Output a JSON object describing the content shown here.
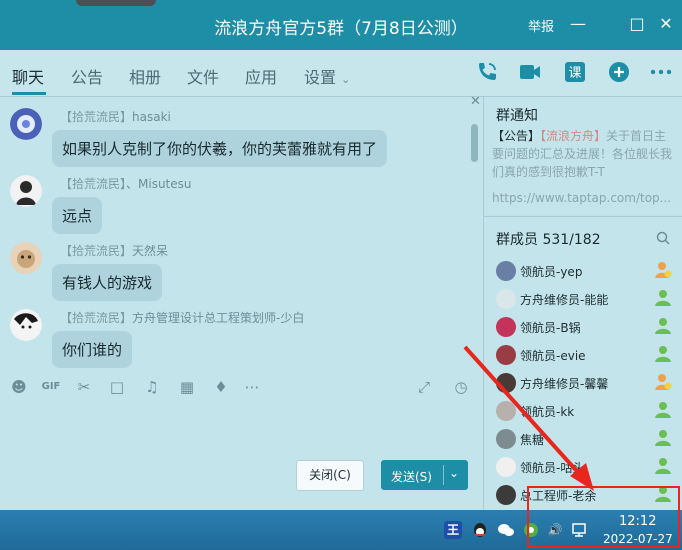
{
  "window": {
    "title": "流浪方舟官方5群（7月8日公测）",
    "report_label": "举报"
  },
  "tabs": [
    {
      "label": "聊天"
    },
    {
      "label": "公告"
    },
    {
      "label": "相册"
    },
    {
      "label": "文件"
    },
    {
      "label": "应用"
    },
    {
      "label": "设置"
    }
  ],
  "toolbar_icons": [
    "phone-icon",
    "video-icon",
    "class-icon",
    "add-icon",
    "more-icon"
  ],
  "messages": [
    {
      "badge": "【拾荒流民】",
      "sender": "hasaki",
      "text": "如果别人克制了你的伏羲，你的芙蕾雅就有用了"
    },
    {
      "badge": "【拾荒流民】",
      "sender": "、Misutesu",
      "text": "远点"
    },
    {
      "badge": "【拾荒流民】",
      "sender": "天然呆",
      "text": "有钱人的游戏"
    },
    {
      "badge": "【拾荒流民】",
      "sender": "方舟管理设计总工程策划师-少白",
      "text": "你们谁的"
    }
  ],
  "input": {
    "close_label": "关闭(C)",
    "send_label": "发送(S)"
  },
  "notice": {
    "title": "群通知",
    "tag": "【公告】",
    "author": "【流浪方舟】",
    "body": "关于首日主要问题的汇总及进展！各位舰长我们真的感到很抱歉T-T",
    "link": "https://www.taptap.com/top..."
  },
  "members": {
    "title": "群成员 531/182",
    "list": [
      {
        "name": "领航员-yep",
        "role": "owner"
      },
      {
        "name": "方舟维修员-能能",
        "role": "member"
      },
      {
        "name": "领航员-B锅",
        "role": "member"
      },
      {
        "name": "领航员-evie",
        "role": "member"
      },
      {
        "name": "方舟维修员-馨馨",
        "role": "owner"
      },
      {
        "name": "领航员-kk",
        "role": "member"
      },
      {
        "name": "焦糖",
        "role": "member"
      },
      {
        "name": "领航员-咕头",
        "role": "member"
      },
      {
        "name": "总工程师-老余",
        "role": "member"
      }
    ]
  },
  "taskbar": {
    "time": "12:12",
    "date": "2022-07-27"
  },
  "colors": {
    "titlebar": "#1d8ea6",
    "annotation_red": "#e8261e"
  }
}
